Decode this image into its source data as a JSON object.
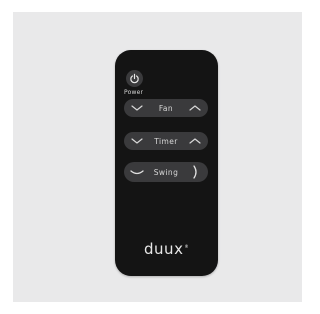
{
  "remote": {
    "power_label": "Power",
    "fan_label": "Fan",
    "timer_label": "Timer",
    "swing_label": "Swing",
    "brand": "duux",
    "brand_mark": "®"
  },
  "icons": {
    "power": "power-icon",
    "down": "chevron-down-icon",
    "up": "chevron-up-icon",
    "swing_left": "curve-icon",
    "swing_right": "arc-icon"
  },
  "colors": {
    "background": "#e9e9ea",
    "remote_body": "#141414",
    "button": "#3a3a3c",
    "text": "#d8d8d8"
  }
}
